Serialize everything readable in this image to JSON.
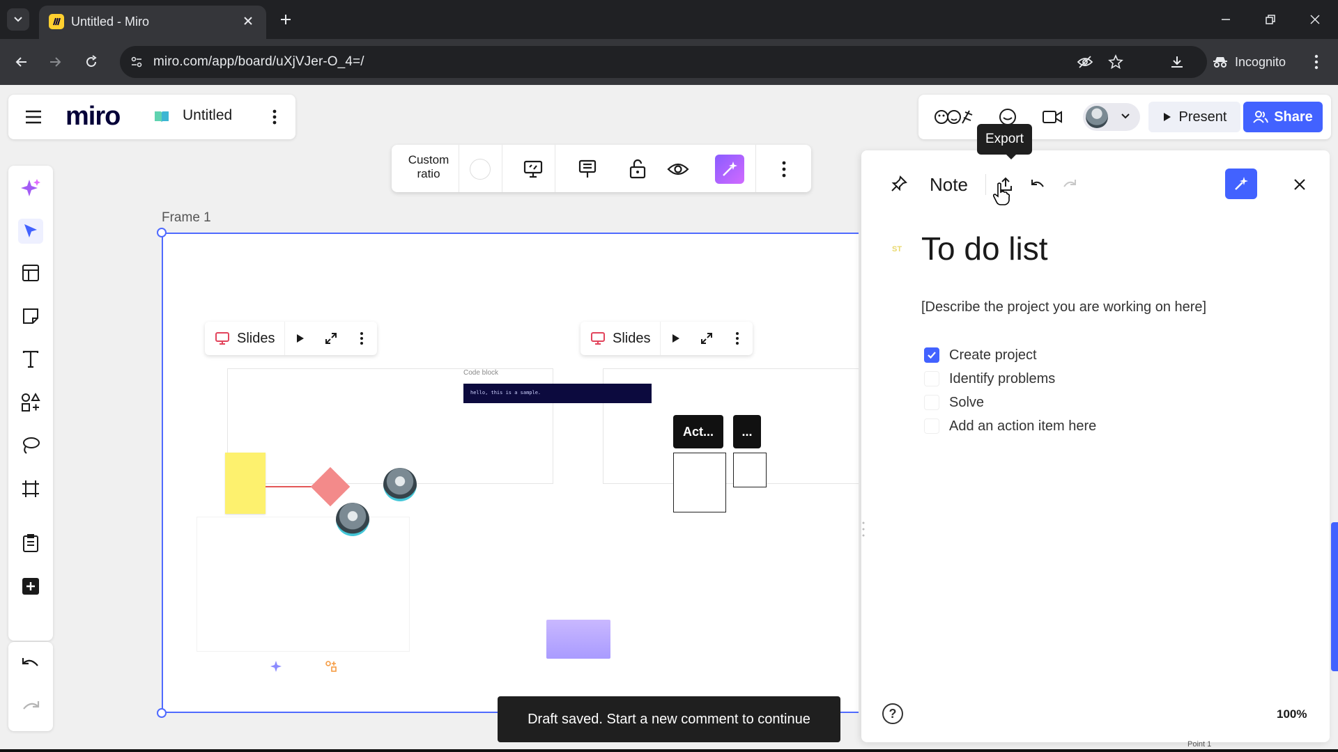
{
  "browser": {
    "tab_title": "Untitled - Miro",
    "url": "miro.com/app/board/uXjVJer-O_4=/",
    "incognito_label": "Incognito"
  },
  "miro": {
    "logo": "miro",
    "board_name": "Untitled",
    "present_label": "Present",
    "share_label": "Share",
    "tooltip": "Export",
    "brand_color": "#4262ff"
  },
  "frame_toolbar": {
    "ratio_label": "Custom\nratio"
  },
  "canvas": {
    "frame_label": "Frame 1",
    "slides_label_1": "Slides",
    "slides_label_2": "Slides",
    "code_caption": "Code block",
    "code_text": "hello, this is a sample.",
    "act_label": "Act...",
    "dots_label": "...",
    "toast": "Draft saved. Start a new comment to continue",
    "point_label": "Point 1"
  },
  "note_panel": {
    "title": "Note",
    "author_tag": "ST",
    "heading": "To do list",
    "description": "[Describe the project you are working on here]",
    "todos": [
      {
        "label": "Create project",
        "checked": true
      },
      {
        "label": "Identify problems",
        "checked": false
      },
      {
        "label": "Solve",
        "checked": false
      },
      {
        "label": "Add an action item here",
        "checked": false
      }
    ],
    "help": "?",
    "zoom": "100%"
  }
}
